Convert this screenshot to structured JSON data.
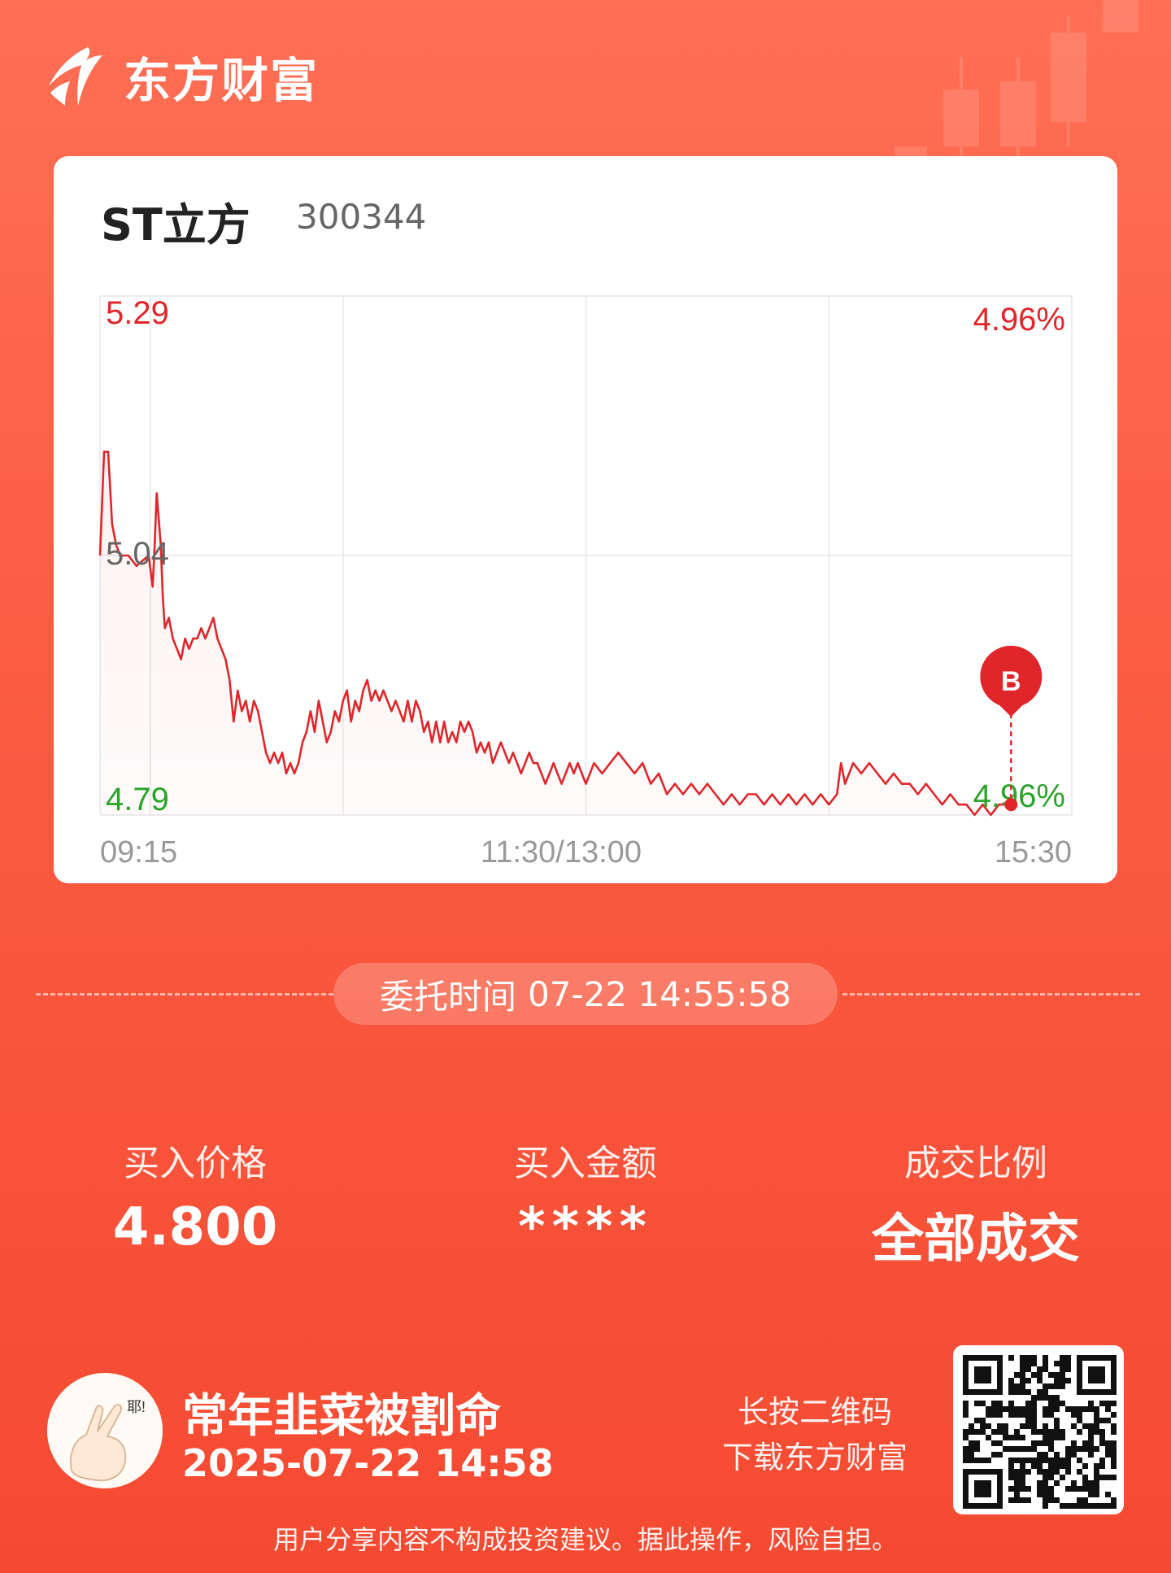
{
  "brand": {
    "name": "东方财富"
  },
  "stock": {
    "name": "ST立方",
    "code": "300344"
  },
  "chart_data": {
    "type": "line",
    "price_high_label": "5.29",
    "price_mid_label": "5.04",
    "price_low_label": "4.79",
    "pct_high_label": "4.96%",
    "pct_low_label": "4.96%",
    "time_labels": [
      "09:15",
      "11:30/13:00",
      "15:30"
    ],
    "marker_label": "B",
    "ylim": [
      4.79,
      5.29
    ],
    "x_range_minutes": [
      0,
      240
    ],
    "buy_point": {
      "t": 225,
      "price": 4.8
    },
    "series": [
      {
        "values": [
          [
            0,
            5.04
          ],
          [
            1,
            5.14
          ],
          [
            2,
            5.14
          ],
          [
            3,
            5.07
          ],
          [
            4,
            5.05
          ],
          [
            5,
            5.04
          ],
          [
            7,
            5.04
          ],
          [
            9,
            5.03
          ],
          [
            12,
            5.04
          ],
          [
            13,
            5.01
          ],
          [
            13.5,
            5.05
          ],
          [
            14,
            5.1
          ],
          [
            15,
            5.05
          ],
          [
            15.5,
            5.0
          ],
          [
            16,
            4.97
          ],
          [
            17,
            4.98
          ],
          [
            17.5,
            4.97
          ],
          [
            18,
            4.96
          ],
          [
            19,
            4.95
          ],
          [
            20,
            4.94
          ],
          [
            21,
            4.96
          ],
          [
            22,
            4.95
          ],
          [
            23,
            4.96
          ],
          [
            24,
            4.96
          ],
          [
            25,
            4.97
          ],
          [
            26,
            4.96
          ],
          [
            27,
            4.97
          ],
          [
            28,
            4.98
          ],
          [
            29,
            4.96
          ],
          [
            30,
            4.95
          ],
          [
            31,
            4.94
          ],
          [
            32,
            4.92
          ],
          [
            33,
            4.88
          ],
          [
            34,
            4.91
          ],
          [
            35,
            4.89
          ],
          [
            36,
            4.9
          ],
          [
            37,
            4.88
          ],
          [
            38,
            4.9
          ],
          [
            39,
            4.89
          ],
          [
            40,
            4.87
          ],
          [
            41,
            4.85
          ],
          [
            42,
            4.84
          ],
          [
            43,
            4.85
          ],
          [
            44,
            4.84
          ],
          [
            45,
            4.85
          ],
          [
            46,
            4.83
          ],
          [
            47,
            4.84
          ],
          [
            48,
            4.83
          ],
          [
            49,
            4.84
          ],
          [
            50,
            4.86
          ],
          [
            51,
            4.87
          ],
          [
            52,
            4.89
          ],
          [
            53,
            4.87
          ],
          [
            54,
            4.9
          ],
          [
            55,
            4.88
          ],
          [
            56,
            4.86
          ],
          [
            57,
            4.87
          ],
          [
            58,
            4.89
          ],
          [
            59,
            4.88
          ],
          [
            60,
            4.9
          ],
          [
            61,
            4.91
          ],
          [
            62,
            4.88
          ],
          [
            63,
            4.9
          ],
          [
            64,
            4.89
          ],
          [
            65,
            4.91
          ],
          [
            66,
            4.92
          ],
          [
            67,
            4.9
          ],
          [
            68,
            4.91
          ],
          [
            69,
            4.9
          ],
          [
            70,
            4.91
          ],
          [
            71,
            4.9
          ],
          [
            72,
            4.89
          ],
          [
            73,
            4.9
          ],
          [
            74,
            4.89
          ],
          [
            75,
            4.88
          ],
          [
            76,
            4.9
          ],
          [
            77,
            4.88
          ],
          [
            78,
            4.9
          ],
          [
            79,
            4.89
          ],
          [
            80,
            4.87
          ],
          [
            81,
            4.88
          ],
          [
            82,
            4.86
          ],
          [
            83,
            4.88
          ],
          [
            84,
            4.86
          ],
          [
            85,
            4.88
          ],
          [
            86,
            4.86
          ],
          [
            87,
            4.87
          ],
          [
            88,
            4.86
          ],
          [
            89,
            4.88
          ],
          [
            90,
            4.87
          ],
          [
            91,
            4.88
          ],
          [
            92,
            4.87
          ],
          [
            93,
            4.85
          ],
          [
            94,
            4.86
          ],
          [
            95,
            4.85
          ],
          [
            96,
            4.86
          ],
          [
            97,
            4.84
          ],
          [
            98,
            4.85
          ],
          [
            99,
            4.86
          ],
          [
            100,
            4.85
          ],
          [
            101,
            4.84
          ],
          [
            102,
            4.85
          ],
          [
            103,
            4.84
          ],
          [
            104,
            4.83
          ],
          [
            105,
            4.84
          ],
          [
            106,
            4.85
          ],
          [
            107,
            4.84
          ],
          [
            108,
            4.84
          ],
          [
            109,
            4.83
          ],
          [
            110,
            4.82
          ],
          [
            111,
            4.83
          ],
          [
            112,
            4.84
          ],
          [
            113,
            4.83
          ],
          [
            114,
            4.82
          ],
          [
            115,
            4.83
          ],
          [
            116,
            4.84
          ],
          [
            117,
            4.83
          ],
          [
            118,
            4.84
          ],
          [
            119,
            4.83
          ],
          [
            120,
            4.82
          ],
          [
            122,
            4.84
          ],
          [
            124,
            4.83
          ],
          [
            126,
            4.84
          ],
          [
            128,
            4.85
          ],
          [
            130,
            4.84
          ],
          [
            132,
            4.83
          ],
          [
            134,
            4.84
          ],
          [
            136,
            4.82
          ],
          [
            138,
            4.83
          ],
          [
            140,
            4.81
          ],
          [
            142,
            4.82
          ],
          [
            144,
            4.81
          ],
          [
            146,
            4.82
          ],
          [
            148,
            4.81
          ],
          [
            150,
            4.82
          ],
          [
            152,
            4.81
          ],
          [
            154,
            4.8
          ],
          [
            156,
            4.81
          ],
          [
            158,
            4.8
          ],
          [
            160,
            4.81
          ],
          [
            162,
            4.81
          ],
          [
            164,
            4.8
          ],
          [
            166,
            4.81
          ],
          [
            168,
            4.8
          ],
          [
            170,
            4.81
          ],
          [
            172,
            4.8
          ],
          [
            174,
            4.81
          ],
          [
            176,
            4.8
          ],
          [
            178,
            4.81
          ],
          [
            180,
            4.8
          ],
          [
            182,
            4.81
          ],
          [
            183,
            4.84
          ],
          [
            184,
            4.82
          ],
          [
            186,
            4.84
          ],
          [
            188,
            4.83
          ],
          [
            190,
            4.84
          ],
          [
            192,
            4.83
          ],
          [
            194,
            4.82
          ],
          [
            196,
            4.83
          ],
          [
            198,
            4.82
          ],
          [
            200,
            4.82
          ],
          [
            202,
            4.81
          ],
          [
            204,
            4.82
          ],
          [
            206,
            4.81
          ],
          [
            208,
            4.8
          ],
          [
            210,
            4.81
          ],
          [
            212,
            4.8
          ],
          [
            214,
            4.8
          ],
          [
            216,
            4.79
          ],
          [
            218,
            4.8
          ],
          [
            220,
            4.79
          ],
          [
            222,
            4.8
          ],
          [
            224,
            4.8
          ],
          [
            225,
            4.8
          ]
        ]
      }
    ]
  },
  "order": {
    "time_label": "委托时间",
    "time_value": "07-22 14:55:58"
  },
  "stats": [
    {
      "label": "买入价格",
      "value": "4.800"
    },
    {
      "label": "买入金额",
      "value": "****"
    },
    {
      "label": "成交比例",
      "value": "全部成交"
    }
  ],
  "user": {
    "name": "常年韭菜被割命",
    "time": "2025-07-22 14:58",
    "avatar_text": "耶!"
  },
  "qr": {
    "line1": "长按二维码",
    "line2": "下载东方财富"
  },
  "disclaimer": "用户分享内容不构成投资建议。据此操作，风险自担。",
  "colors": {
    "up": "#e0262a",
    "down": "#2aa52a",
    "neutral": "#666666",
    "grid": "#ececec",
    "bg": "#f95a40"
  }
}
